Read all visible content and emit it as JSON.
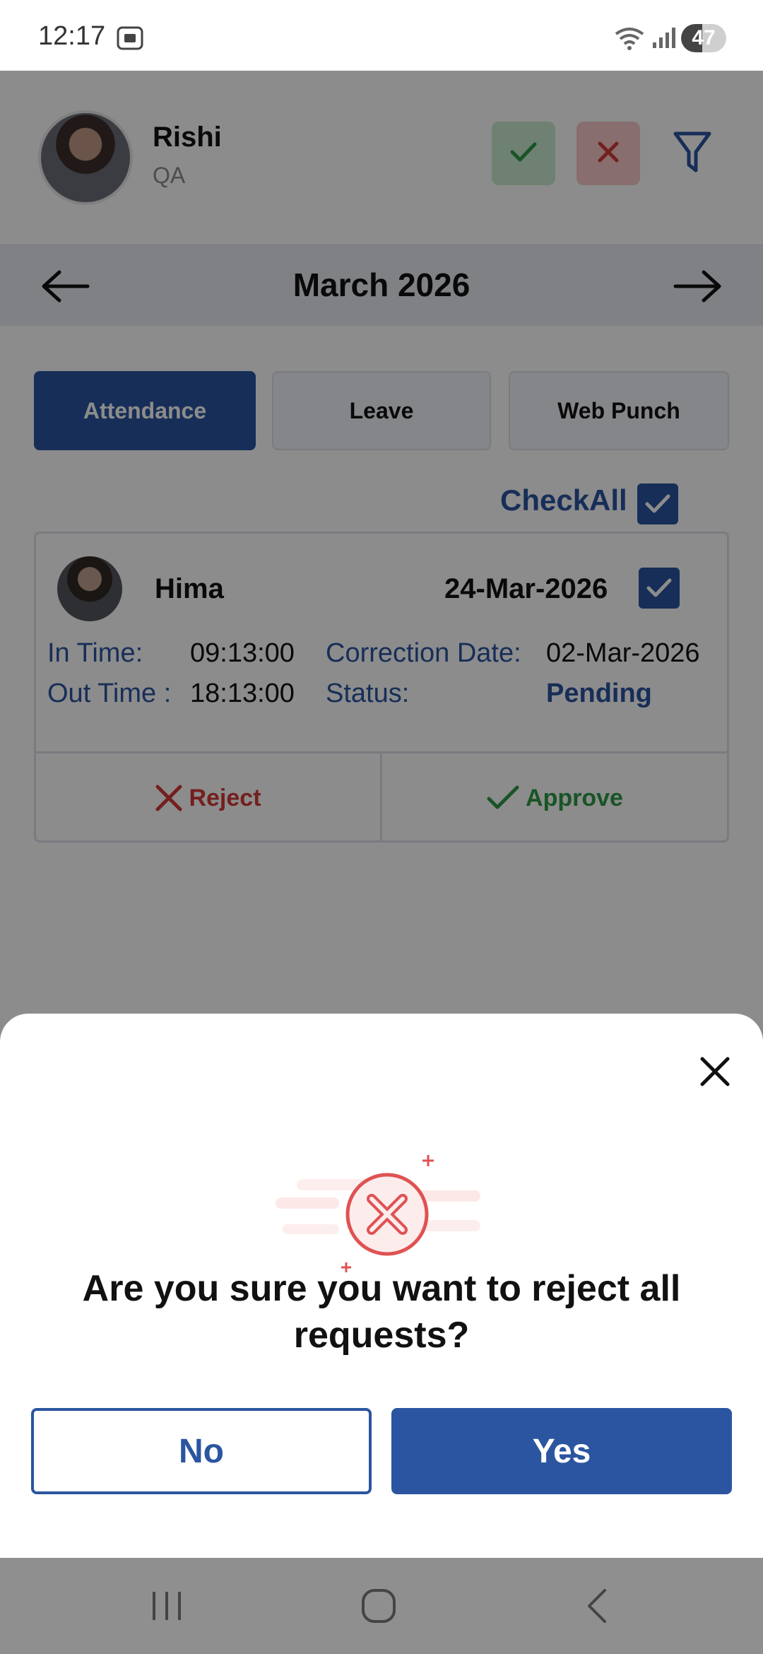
{
  "status_bar": {
    "time": "12:17",
    "battery": "47",
    "battery_level": 0.47
  },
  "header": {
    "user_name": "Rishi",
    "user_role": "QA"
  },
  "month_nav": {
    "month": "March 2026"
  },
  "tabs": [
    {
      "label": "Attendance",
      "active": true
    },
    {
      "label": "Leave",
      "active": false
    },
    {
      "label": "Web Punch",
      "active": false
    }
  ],
  "check_all": {
    "label": "CheckAll",
    "checked": true
  },
  "request_card": {
    "name": "Hima",
    "date": "24-Mar-2026",
    "checked": true,
    "in_time_label": "In Time:",
    "in_time": "09:13:00",
    "out_time_label": "Out Time :",
    "out_time": "18:13:00",
    "correction_label": "Correction Date:",
    "correction_date": "02-Mar-2026",
    "status_label": "Status:",
    "status": "Pending",
    "reject_label": "Reject",
    "approve_label": "Approve"
  },
  "dialog": {
    "question": "Are you sure you want to reject all requests?",
    "no_label": "No",
    "yes_label": "Yes"
  },
  "colors": {
    "primary": "#2b55a0",
    "reject": "#d33a3a",
    "approve": "#2f9a45"
  }
}
